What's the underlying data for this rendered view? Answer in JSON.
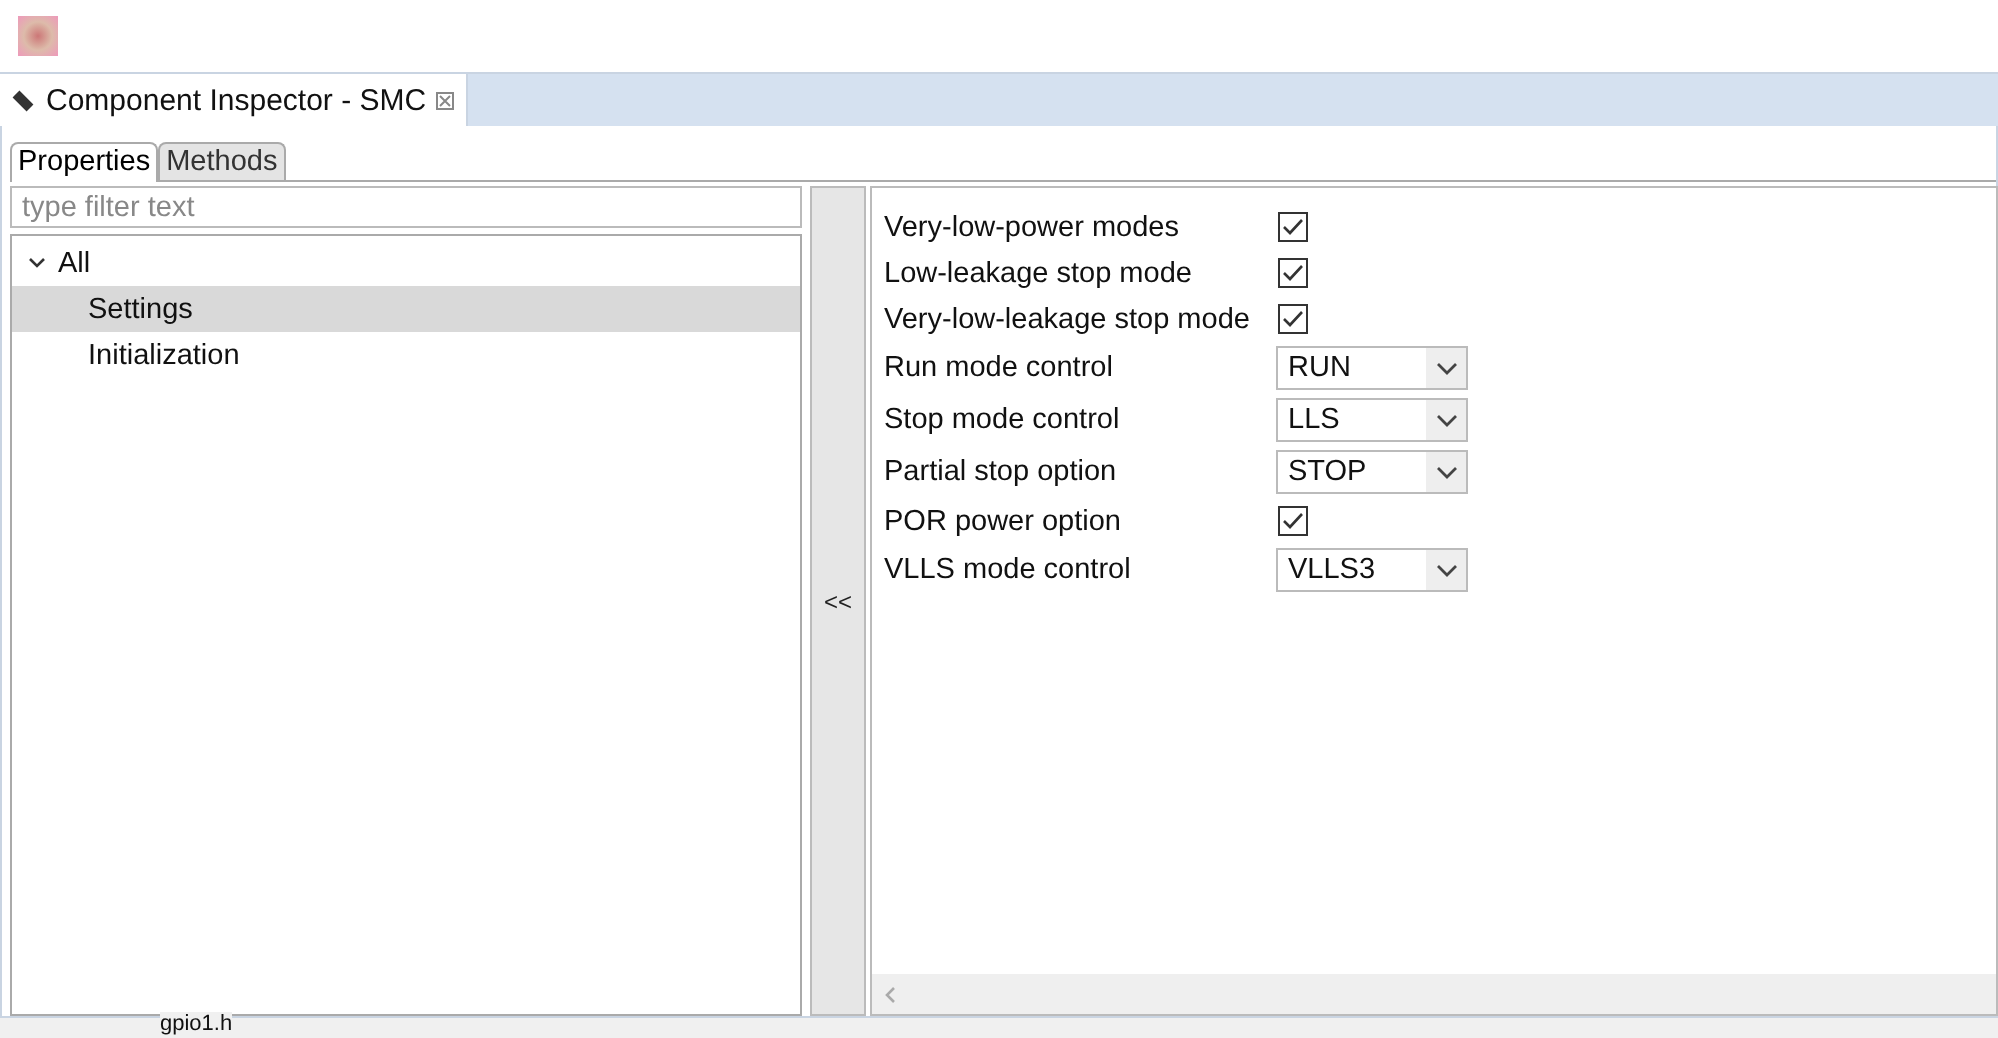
{
  "view_tab": {
    "title": "Component Inspector - SMC"
  },
  "tabs": [
    {
      "label": "Properties",
      "selected": true
    },
    {
      "label": "Methods",
      "selected": false
    }
  ],
  "filter": {
    "placeholder": "type filter text"
  },
  "tree": [
    {
      "label": "All",
      "expanded": true,
      "selected": false,
      "children": [
        {
          "label": "Settings",
          "selected": true
        },
        {
          "label": "Initialization",
          "selected": false
        }
      ]
    }
  ],
  "collapse_button": "<<",
  "properties": [
    {
      "kind": "check",
      "label": "Very-low-power modes",
      "checked": true
    },
    {
      "kind": "check",
      "label": "Low-leakage stop mode",
      "checked": true
    },
    {
      "kind": "check",
      "label": "Very-low-leakage stop mode",
      "checked": true
    },
    {
      "kind": "combo",
      "label": "Run mode control",
      "value": "RUN"
    },
    {
      "kind": "combo",
      "label": "Stop mode control",
      "value": "LLS"
    },
    {
      "kind": "combo",
      "label": "Partial stop option",
      "value": "STOP"
    },
    {
      "kind": "check",
      "label": "POR power option",
      "checked": true
    },
    {
      "kind": "combo",
      "label": "VLLS mode control",
      "value": "VLLS3"
    }
  ],
  "behind": {
    "file": "gpio1.h"
  }
}
